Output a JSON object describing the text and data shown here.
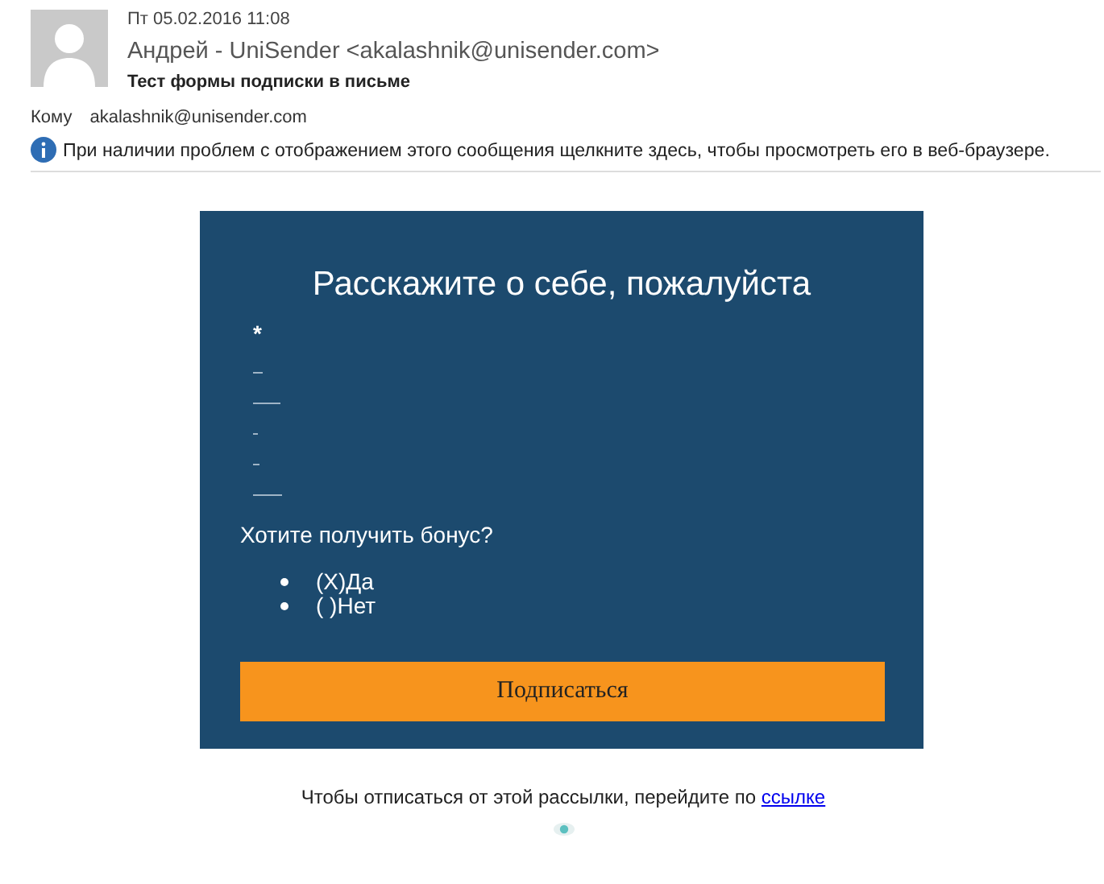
{
  "message": {
    "date": "Пт 05.02.2016 11:08",
    "sender": "Андрей - UniSender <akalashnik@unisender.com>",
    "subject": "Тест формы подписки в письме",
    "to_label": "Кому",
    "to": "akalashnik@unisender.com",
    "info": "При наличии проблем с отображением этого сообщения щелкните здесь, чтобы просмотреть его в веб-браузере."
  },
  "form": {
    "title": "Расскажите о себе, пожалуйста",
    "required_mark": "*",
    "question": "Хотите получить бонус?",
    "options": [
      "(X)Да",
      "( )Нет"
    ],
    "submit": "Подписаться"
  },
  "footer": {
    "text": "Чтобы отписаться от этой рассылки, перейдите по ",
    "link": "ссылке"
  }
}
